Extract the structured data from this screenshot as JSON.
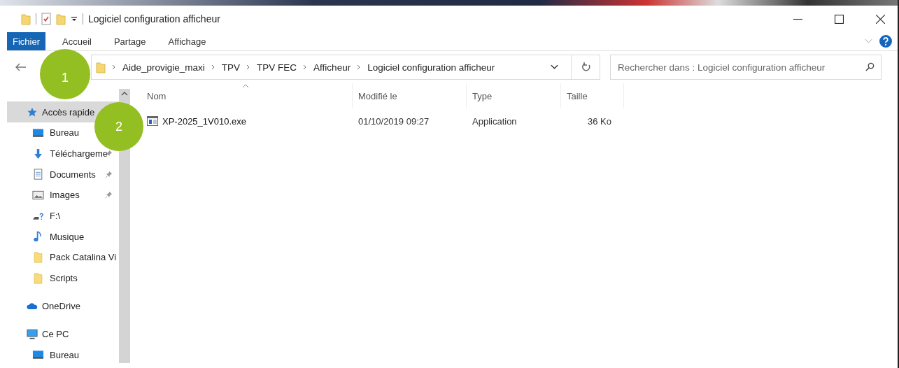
{
  "window": {
    "title": "Logiciel configuration afficheur"
  },
  "ribbon_tabs": [
    {
      "label": "Fichier",
      "selected": true
    },
    {
      "label": "Accueil",
      "selected": false
    },
    {
      "label": "Partage",
      "selected": false
    },
    {
      "label": "Affichage",
      "selected": false
    }
  ],
  "address_bar": {
    "path": [
      "Aide_provigie_maxi",
      "TPV",
      "TPV FEC",
      "Afficheur",
      "Logiciel configuration afficheur"
    ]
  },
  "search": {
    "placeholder": "Rechercher dans : Logiciel configuration afficheur"
  },
  "sidebar": {
    "items": [
      {
        "label": "Accès rapide",
        "kind": "star",
        "selected": true,
        "children": [
          {
            "label": "Bureau",
            "kind": "desktop",
            "pinned": false
          },
          {
            "label": "Téléchargeme",
            "kind": "download",
            "pinned": true
          },
          {
            "label": "Documents",
            "kind": "document",
            "pinned": true
          },
          {
            "label": "Images",
            "kind": "image",
            "pinned": true
          },
          {
            "label": "F:\\",
            "kind": "drive",
            "pinned": false
          },
          {
            "label": "Musique",
            "kind": "music",
            "pinned": false
          },
          {
            "label": "Pack Catalina Vi",
            "kind": "folder",
            "pinned": false
          },
          {
            "label": "Scripts",
            "kind": "folder",
            "pinned": false
          }
        ]
      },
      {
        "label": "OneDrive",
        "kind": "cloud",
        "selected": false
      },
      {
        "label": "Ce PC",
        "kind": "pc",
        "selected": false,
        "children": [
          {
            "label": "Bureau",
            "kind": "desktop",
            "pinned": false
          }
        ]
      }
    ]
  },
  "table": {
    "columns": [
      {
        "label": "Nom",
        "sorted": true
      },
      {
        "label": "Modifié le",
        "sorted": false
      },
      {
        "label": "Type",
        "sorted": false
      },
      {
        "label": "Taille",
        "sorted": false
      }
    ],
    "rows": [
      {
        "cells": [
          "XP-2025_1V010.exe",
          "01/10/2019 09:27",
          "Application",
          "36 Ko"
        ]
      }
    ]
  },
  "callouts": [
    "1",
    "2"
  ]
}
